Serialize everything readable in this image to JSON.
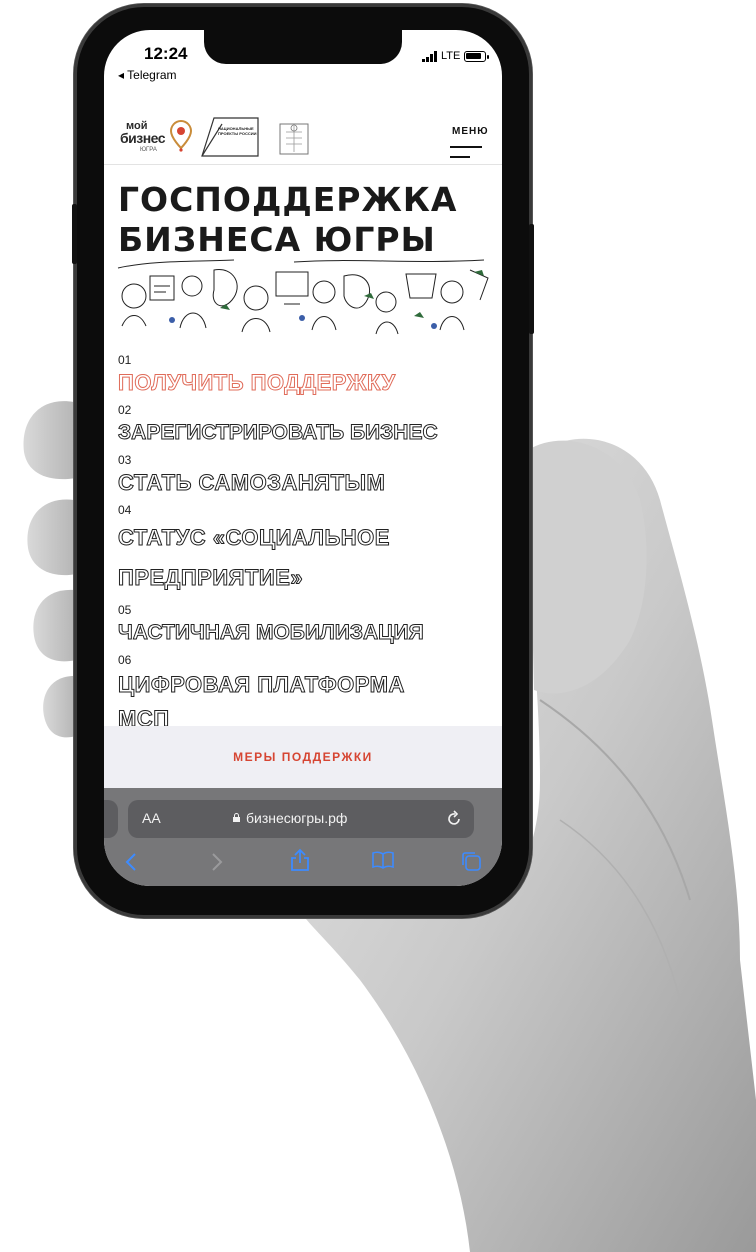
{
  "status_bar": {
    "time": "12:24",
    "back_app": "◂ Telegram",
    "network": "LTE"
  },
  "header": {
    "logo_moy": "мой",
    "logo_biznes": "бизнес",
    "logo_region": "ЮГРА",
    "natproject_logo_text": "НАЦИОНАЛЬНЫЕ ПРОЕКТЫ РОССИИ",
    "menu_label": "МЕНЮ"
  },
  "page": {
    "title": "ГОСПОДДЕРЖКА\nБИЗНЕСА ЮГРЫ",
    "nav": [
      {
        "num": "01",
        "label": "ПОЛУЧИТЬ ПОДДЕРЖКУ",
        "active": true
      },
      {
        "num": "02",
        "label": "ЗАРЕГИСТРИРОВАТЬ БИЗНЕС",
        "active": false
      },
      {
        "num": "03",
        "label": "СТАТЬ САМОЗАНЯТЫМ",
        "active": false
      },
      {
        "num": "04",
        "label": "СТАТУС «СОЦИАЛЬНОЕ ПРЕДПРИЯТИЕ»",
        "active": false
      },
      {
        "num": "05",
        "label": "ЧАСТИЧНАЯ МОБИЛИЗАЦИЯ",
        "active": false
      },
      {
        "num": "06",
        "label": "ЦИФРОВАЯ ПЛАТФОРМА МСП",
        "active": false
      }
    ],
    "cta_label": "МЕРЫ ПОДДЕРЖКИ"
  },
  "browser": {
    "text_size_label": "AA",
    "url": "бизнесюгры.рф",
    "toolbar_icons": [
      "back-icon",
      "forward-icon",
      "share-icon",
      "bookmarks-icon",
      "tabs-icon"
    ]
  },
  "colors": {
    "accent": "#d64532",
    "active_outline": "#e06c5a",
    "cta_bg": "#efeff4",
    "browser_bar": "#777779"
  }
}
